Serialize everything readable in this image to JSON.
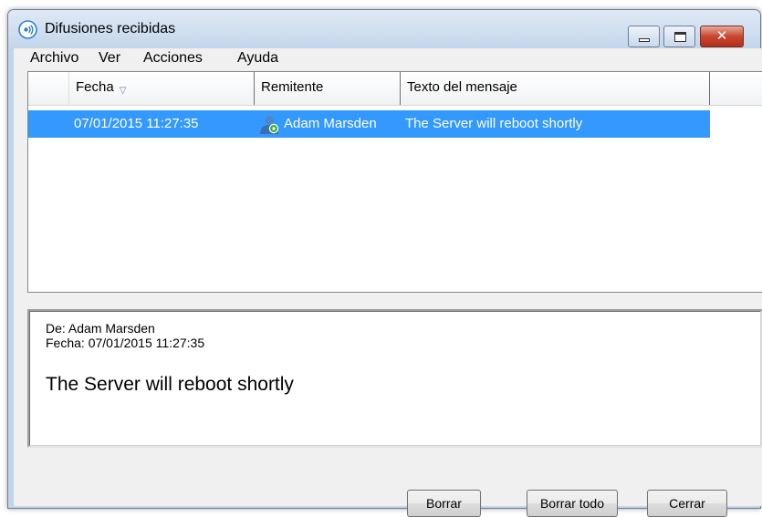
{
  "window": {
    "title": "Difusiones recibidas",
    "controls": {
      "minimize_icon": "minimize-icon",
      "maximize_icon": "maximize-icon",
      "close_icon": "close-icon",
      "close_glyph": "✕"
    }
  },
  "menu": {
    "items": [
      {
        "label": "Archivo"
      },
      {
        "label": "Ver"
      },
      {
        "label": "Acciones"
      },
      {
        "label": "Ayuda"
      }
    ]
  },
  "list": {
    "columns": [
      {
        "label": "Fecha",
        "sorted": "descending"
      },
      {
        "label": "Remitente"
      },
      {
        "label": "Texto del mensaje"
      }
    ],
    "sort_glyph": "▽",
    "rows": [
      {
        "date": "07/01/2015 11:27:35",
        "sender": "Adam Marsden",
        "sender_icon": "user-online-icon",
        "message": "The Server will reboot shortly",
        "selected": true
      }
    ]
  },
  "preview": {
    "from_line": "De: Adam Marsden",
    "date_line": "Fecha: 07/01/2015 11:27:35",
    "body": "The Server will reboot shortly"
  },
  "buttons": {
    "delete": "Borrar",
    "delete_all": "Borrar todo",
    "close": "Cerrar"
  },
  "colors": {
    "selection": "#3399ff",
    "title_bar": "#c8d9ee",
    "close_button": "#c6472f",
    "dialog_background": "#f0f0f0"
  }
}
